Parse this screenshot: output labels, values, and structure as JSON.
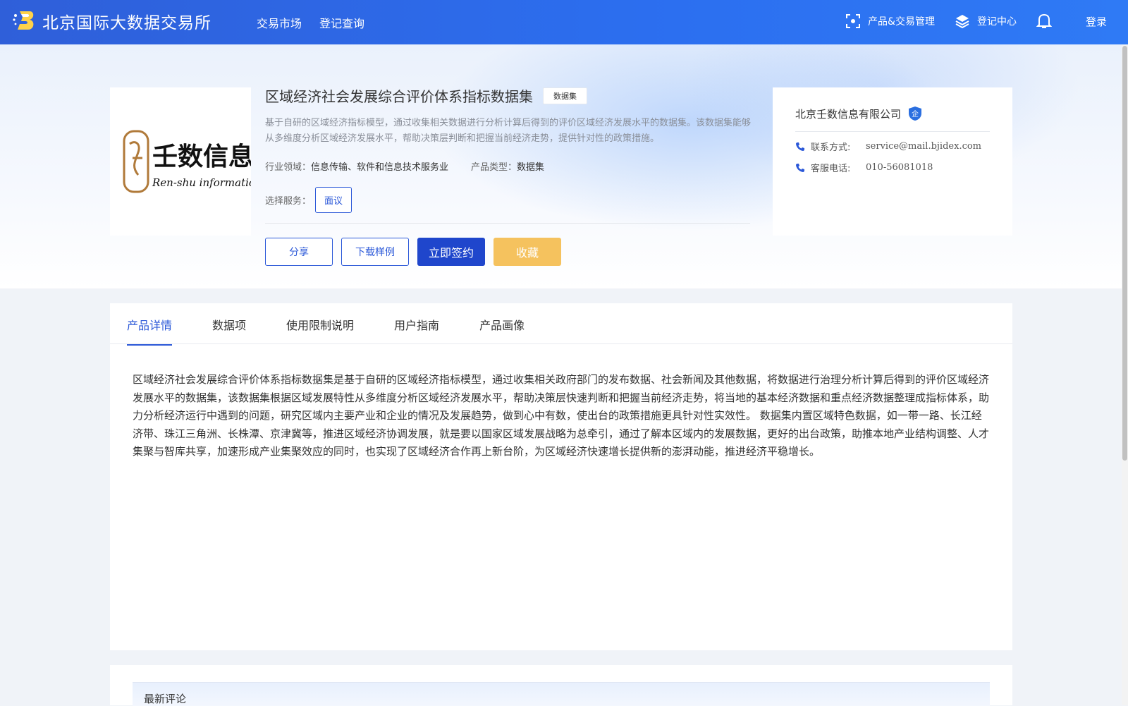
{
  "nav": {
    "brand_name": "北京国际大数据交易所",
    "links": [
      "交易市场",
      "登记查询"
    ],
    "product_manage": "产品&交易管理",
    "register_center": "登记中心",
    "login": "登录"
  },
  "product": {
    "title": "区域经济社会发展综合评价体系指标数据集",
    "badge": "数据集",
    "description": "基于自研的区域经济指标模型，通过收集相关数据进行分析计算后得到的评价区域经济发展水平的数据集。该数据集能够从多维度分析区域经济发展水平，帮助决策层判断和把握当前经济走势，提供针对性的政策措施。",
    "industry_label": "行业领域：",
    "industry_value": "信息传输、软件和信息技术服务业",
    "type_label": "产品类型：",
    "type_value": "数据集",
    "service_label": "选择服务：",
    "service_option": "面议",
    "logo_text_cn": "壬数信息",
    "logo_text_en": "Ren-shu information",
    "actions": {
      "share": "分享",
      "download_sample": "下载样例",
      "sign_now": "立即签约",
      "favorite": "收藏"
    }
  },
  "company": {
    "name": "北京壬数信息有限公司",
    "badge": "企",
    "contact_label": "联系方式:",
    "contact_value": "service@mail.bjidex.com",
    "phone_label": "客服电话:",
    "phone_value": "010-56081018"
  },
  "tabs": [
    "产品详情",
    "数据项",
    "使用限制说明",
    "用户指南",
    "产品画像"
  ],
  "detail": {
    "text": "区域经济社会发展综合评价体系指标数据集是基于自研的区域经济指标模型，通过收集相关政府部门的发布数据、社会新闻及其他数据，将数据进行治理分析计算后得到的评价区域经济发展水平的数据集，该数据集根据区域发展特性从多维度分析区域经济发展水平，帮助决策层快速判断和把握当前经济走势，将当地的基本经济数据和重点经济数据整理成指标体系，助力分析经济运行中遇到的问题，研究区域内主要产业和企业的情况及发展趋势，做到心中有数，使出台的政策措施更具针对性实效性。 数据集内置区域特色数据，如一带一路、长江经济带、珠江三角洲、长株潭、京津冀等，推进区域经济协调发展，就是要以国家区域发展战略为总牵引，通过了解本区域内的发展数据，更好的出台政策，助推本地产业结构调整、人才集聚与智库共享，加速形成产业集聚效应的同时，也实现了区域经济合作再上新台阶，为区域经济快速增长提供新的澎湃动能，推进经济平稳增长。"
  },
  "comments": {
    "title": "最新评论"
  },
  "colors": {
    "primary": "#1f46cc",
    "accent": "#2b58d8",
    "favorite": "#f5c25e"
  }
}
